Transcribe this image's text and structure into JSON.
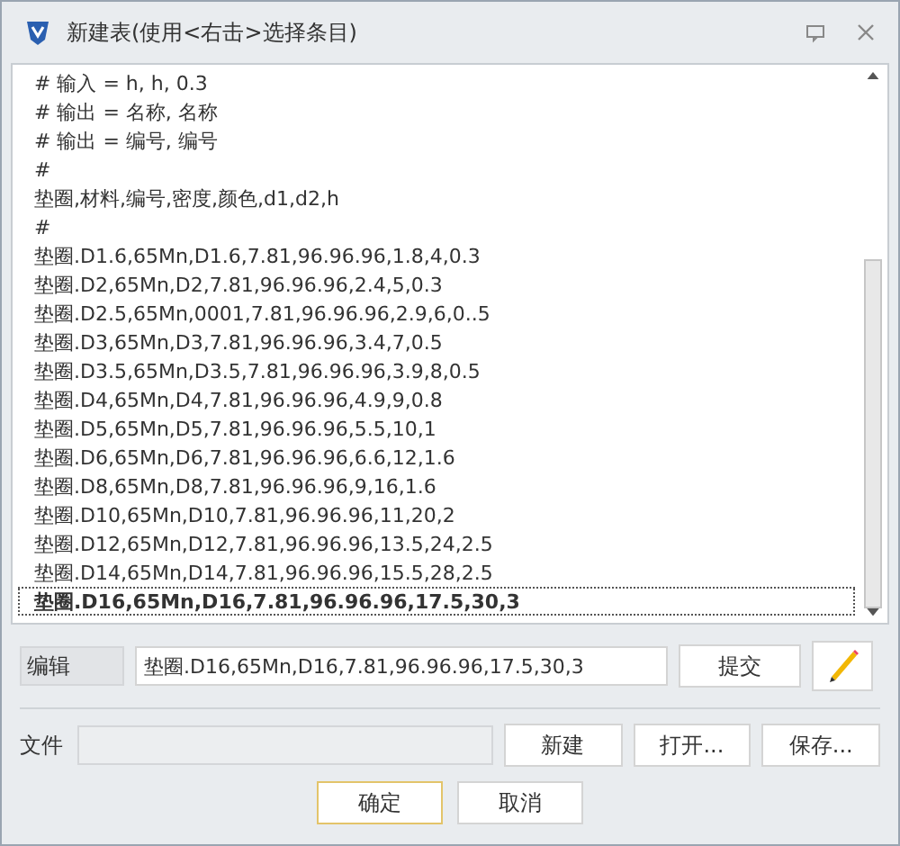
{
  "window": {
    "title": "新建表(使用<右击>选择条目)"
  },
  "lines": [
    {
      "text": "# 输入 = h, h, 0.3",
      "selected": false
    },
    {
      "text": "# 输出 = 名称, 名称",
      "selected": false
    },
    {
      "text": "# 输出 = 编号, 编号",
      "selected": false
    },
    {
      "text": "#",
      "selected": false
    },
    {
      "text": "垫圈,材料,编号,密度,颜色,d1,d2,h",
      "selected": false
    },
    {
      "text": "#",
      "selected": false
    },
    {
      "text": "垫圈.D1.6,65Mn,D1.6,7.81,96.96.96,1.8,4,0.3",
      "selected": false
    },
    {
      "text": "垫圈.D2,65Mn,D2,7.81,96.96.96,2.4,5,0.3",
      "selected": false
    },
    {
      "text": "垫圈.D2.5,65Mn,0001,7.81,96.96.96,2.9,6,0..5",
      "selected": false
    },
    {
      "text": "垫圈.D3,65Mn,D3,7.81,96.96.96,3.4,7,0.5",
      "selected": false
    },
    {
      "text": "垫圈.D3.5,65Mn,D3.5,7.81,96.96.96,3.9,8,0.5",
      "selected": false
    },
    {
      "text": "垫圈.D4,65Mn,D4,7.81,96.96.96,4.9,9,0.8",
      "selected": false
    },
    {
      "text": "垫圈.D5,65Mn,D5,7.81,96.96.96,5.5,10,1",
      "selected": false
    },
    {
      "text": "垫圈.D6,65Mn,D6,7.81,96.96.96,6.6,12,1.6",
      "selected": false
    },
    {
      "text": "垫圈.D8,65Mn,D8,7.81,96.96.96,9,16,1.6",
      "selected": false
    },
    {
      "text": "垫圈.D10,65Mn,D10,7.81,96.96.96,11,20,2",
      "selected": false
    },
    {
      "text": "垫圈.D12,65Mn,D12,7.81,96.96.96,13.5,24,2.5",
      "selected": false
    },
    {
      "text": "垫圈.D14,65Mn,D14,7.81,96.96.96,15.5,28,2.5",
      "selected": false
    },
    {
      "text": "垫圈.D16,65Mn,D16,7.81,96.96.96,17.5,30,3",
      "selected": true
    }
  ],
  "edit": {
    "label": "编辑",
    "value": "垫圈.D16,65Mn,D16,7.81,96.96.96,17.5,30,3",
    "submit": "提交"
  },
  "file": {
    "label": "文件",
    "buttons": [
      "新建",
      "打开...",
      "保存..."
    ]
  },
  "dialog_buttons": [
    {
      "label": "确定",
      "default": true
    },
    {
      "label": "取消",
      "default": false
    }
  ]
}
